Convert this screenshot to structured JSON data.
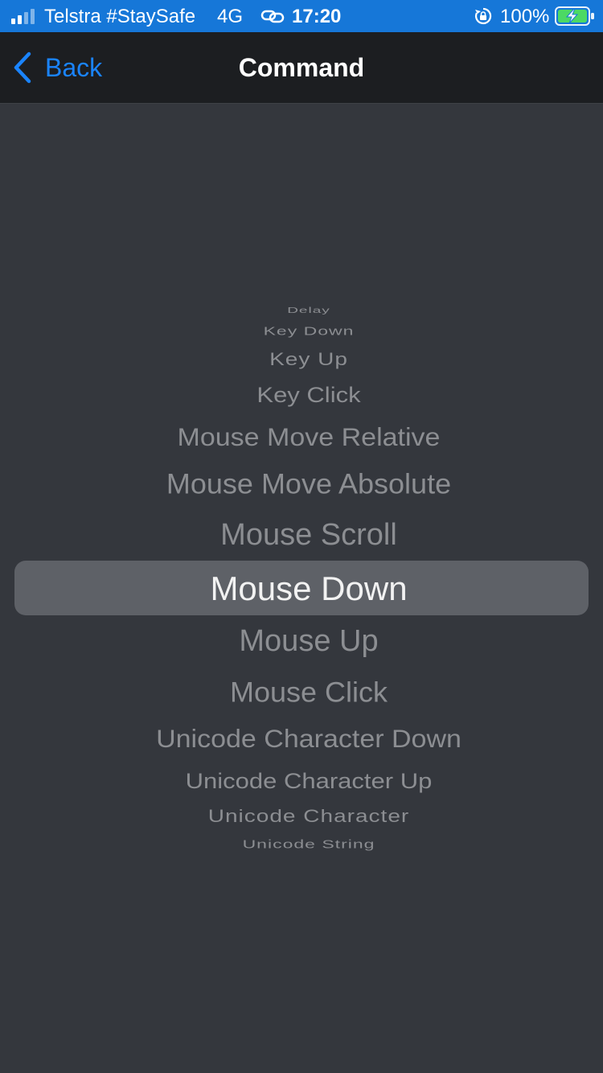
{
  "status_bar": {
    "carrier": "Telstra #StaySafe",
    "network": "4G",
    "time": "17:20",
    "battery_percent": "100%",
    "background_color": "#1677d8",
    "battery_color": "#4cd964",
    "icons": [
      "signal-bars-icon",
      "link-icon",
      "rotation-lock-icon",
      "battery-charging-icon"
    ]
  },
  "nav": {
    "back_label": "Back",
    "title": "Command",
    "accent_color": "#1a84ff"
  },
  "picker": {
    "selected_index": 7,
    "items": [
      "Delay",
      "Key Down",
      "Key Up",
      "Key Click",
      "Mouse Move Relative",
      "Mouse Move Absolute",
      "Mouse Scroll",
      "Mouse Down",
      "Mouse Up",
      "Mouse Click",
      "Unicode Character Down",
      "Unicode Character Up",
      "Unicode Character",
      "Unicode String"
    ]
  }
}
